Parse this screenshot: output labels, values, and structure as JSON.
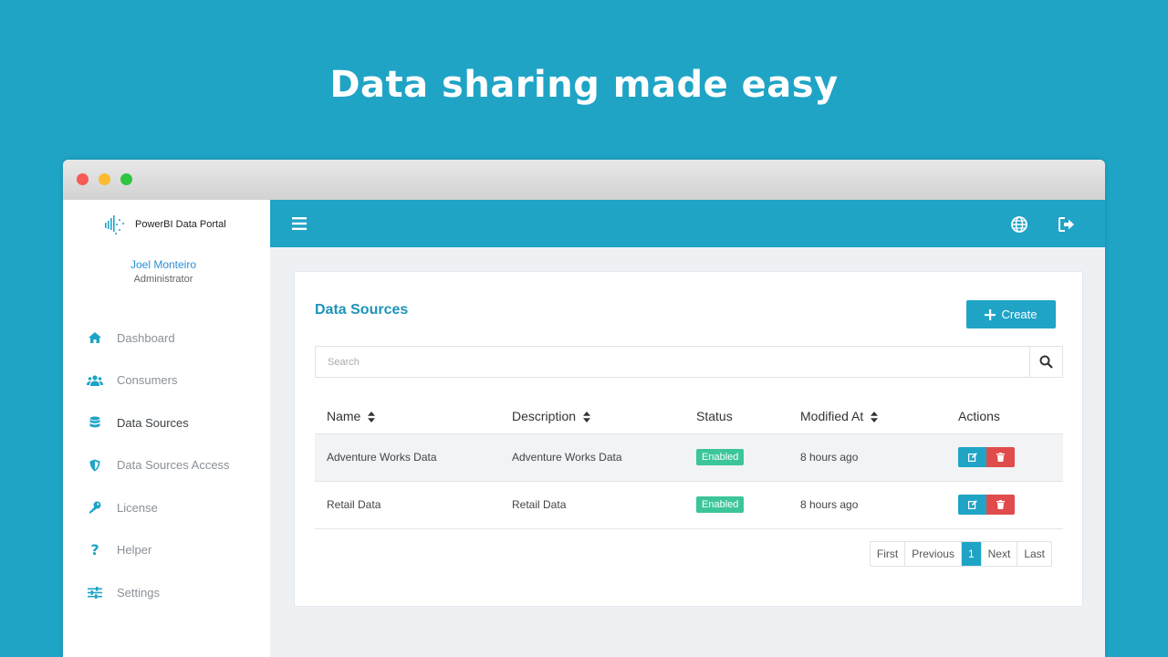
{
  "hero": {
    "title": "Data sharing made easy"
  },
  "brand": {
    "name": "PowerBI Data Portal"
  },
  "user": {
    "name": "Joel Monteiro",
    "role": "Administrator"
  },
  "sidebar": {
    "items": [
      {
        "label": "Dashboard",
        "icon": "home-icon"
      },
      {
        "label": "Consumers",
        "icon": "users-icon"
      },
      {
        "label": "Data Sources",
        "icon": "database-icon",
        "active": true
      },
      {
        "label": "Data Sources Access",
        "icon": "shield-icon"
      },
      {
        "label": "License",
        "icon": "key-icon"
      },
      {
        "label": "Helper",
        "icon": "question-icon"
      },
      {
        "label": "Settings",
        "icon": "sliders-icon"
      }
    ]
  },
  "topbar": {
    "icons": [
      "menu-icon",
      "globe-icon",
      "logout-icon"
    ]
  },
  "main": {
    "title": "Data Sources",
    "create_label": "Create",
    "search": {
      "placeholder": "Search",
      "value": ""
    },
    "table": {
      "columns": [
        "Name",
        "Description",
        "Status",
        "Modified At",
        "Actions"
      ],
      "rows": [
        {
          "name": "Adventure Works Data",
          "description": "Adventure Works Data",
          "status": "Enabled",
          "modified": "8 hours ago"
        },
        {
          "name": "Retail Data",
          "description": "Retail Data",
          "status": "Enabled",
          "modified": "8 hours ago"
        }
      ]
    },
    "pagination": {
      "first": "First",
      "previous": "Previous",
      "current": "1",
      "next": "Next",
      "last": "Last"
    }
  },
  "colors": {
    "accent": "#1fa4c6",
    "success": "#3cc59a",
    "danger": "#e04c4c",
    "link": "#2a8fd8"
  }
}
